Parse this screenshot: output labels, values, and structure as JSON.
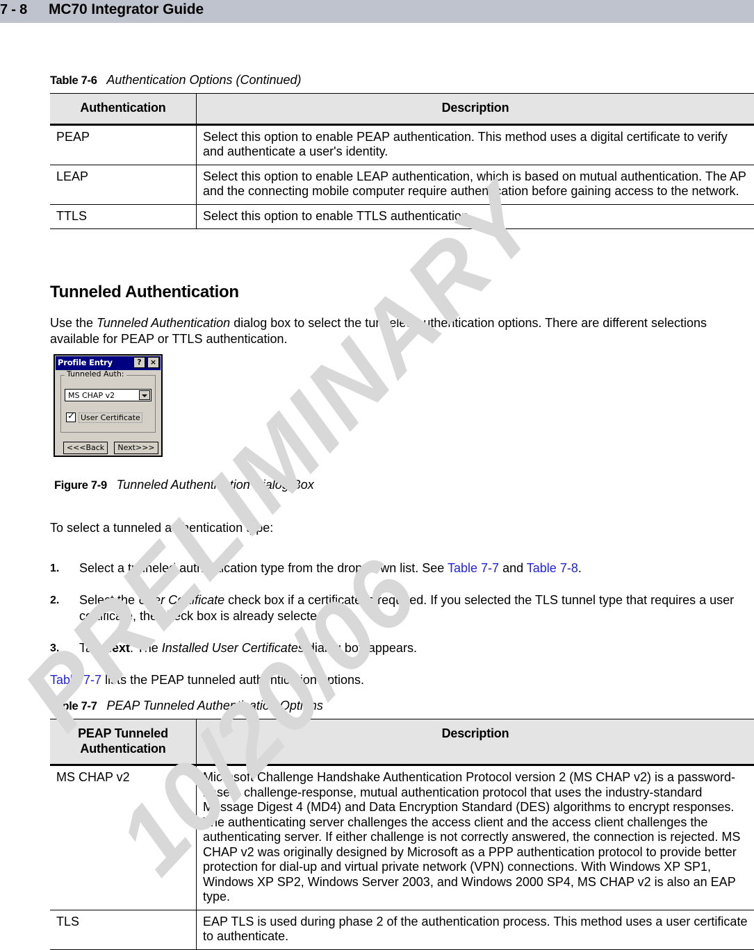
{
  "header": {
    "folio": "7 - 8",
    "book_title": "MC70 Integrator Guide"
  },
  "watermark": {
    "line1": "PRELIMINARY",
    "line2": "10/20/06"
  },
  "table_7_6": {
    "caption_number": "Table 7-6",
    "caption_text": "Authentication Options (Continued)",
    "columns": [
      "Authentication",
      "Description"
    ],
    "rows": [
      {
        "key": "PEAP",
        "description": "Select this option to enable PEAP authentication. This method uses a digital certificate to verify and authenticate a user's identity."
      },
      {
        "key": "LEAP",
        "description": "Select this option to enable LEAP authentication, which is based on mutual authentication. The AP and the connecting mobile computer require authentication before gaining access to the network."
      },
      {
        "key": "TTLS",
        "description": "Select this option to enable TTLS authentication."
      }
    ]
  },
  "section": {
    "heading": "Tunneled Authentication",
    "intro_1": "Use the ",
    "intro_em": "Tunneled Authentication",
    "intro_2": " dialog box to select the tunneled authentication options. There are different selections available for PEAP or TTLS authentication."
  },
  "dialog": {
    "title": "Profile Entry",
    "help_button": "?",
    "close_button": "×",
    "group_label": "Tunneled Auth:",
    "combo_value": "MS CHAP v2",
    "checkbox_label": "User Certificate",
    "back_button": "<<<Back",
    "next_button": "Next>>>"
  },
  "figure_7_9": {
    "caption_number": "Figure 7-9",
    "caption_text": "Tunneled Authentication Dialog Box"
  },
  "procedure": {
    "lead_in": "To select a tunneled authentication type:",
    "steps": [
      {
        "num": "1.",
        "pre": "Select a tunneled authentication type from the drop-down list. See ",
        "xref1": "Table 7-7",
        "mid": " and ",
        "xref2": "Table 7-8",
        "post": "."
      },
      {
        "num": "2.",
        "pre": "Select the ",
        "em": "User Certificate",
        "post": " check box if a certificate is required. If you selected the TLS tunnel type that requires a user certificate, the check box is already selected."
      },
      {
        "num": "3.",
        "pre": "Tap ",
        "strong": "Next",
        "mid": ". The ",
        "em": "Installed User Certificates",
        "post": " dialog box appears."
      }
    ]
  },
  "lead_paragraph": {
    "xref": "Table 7-7",
    "text": " lists the PEAP tunneled authentication options."
  },
  "table_7_7": {
    "caption_number": "Table 7-7",
    "caption_text": "PEAP Tunneled Authentication Options",
    "columns": [
      "PEAP Tunneled Authentication",
      "Description"
    ],
    "column_key_line1": "PEAP Tunneled",
    "column_key_line2": "Authentication",
    "rows": [
      {
        "key": "MS CHAP v2",
        "description": "Microsoft Challenge Handshake Authentication Protocol version 2 (MS CHAP v2) is a password-based, challenge-response, mutual authentication protocol that uses the industry-standard Message Digest 4 (MD4) and Data Encryption Standard (DES) algorithms to encrypt responses. The authenticating server challenges the access client and the access client challenges the authenticating server. If either challenge is not correctly answered, the connection is rejected. MS CHAP v2 was originally designed by Microsoft as a PPP authentication protocol to provide better protection for dial-up and virtual private network (VPN) connections. With Windows XP SP1, Windows XP SP2, Windows Server 2003, and Windows 2000 SP4, MS CHAP v2 is also an EAP type."
      },
      {
        "key": "TLS",
        "description": "EAP TLS is used during phase 2 of the authentication process. This method uses a user certificate to authenticate."
      }
    ]
  }
}
